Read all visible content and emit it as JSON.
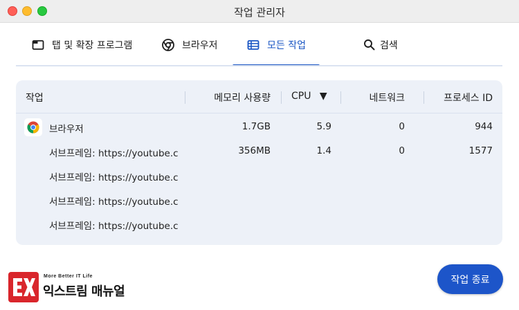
{
  "window": {
    "title": "작업 관리자"
  },
  "tabs": [
    {
      "label": "탭 및 확장 프로그램",
      "icon": "tab-window-icon"
    },
    {
      "label": "브라우저",
      "icon": "chrome-icon"
    },
    {
      "label": "모든 작업",
      "icon": "list-table-icon",
      "active": true
    },
    {
      "label": "검색",
      "icon": "search-icon"
    }
  ],
  "table": {
    "headers": {
      "task": "작업",
      "memory": "메모리 사용량",
      "cpu": "CPU",
      "cpu_sort": "▼",
      "network": "네트워크",
      "pid": "프로세스 ID"
    },
    "rows": [
      {
        "name": "브라우저",
        "memory": "1.7GB",
        "cpu": "5.9",
        "network": "0",
        "pid": "944"
      },
      {
        "name": "서브프레임: https://youtube.com",
        "memory": "356MB",
        "cpu": "1.4",
        "network": "0",
        "pid": "1577"
      },
      {
        "name": "서브프레임: https://youtube.com",
        "memory": "",
        "cpu": "",
        "network": "",
        "pid": ""
      },
      {
        "name": "서브프레임: https://youtube.com",
        "memory": "",
        "cpu": "",
        "network": "",
        "pid": ""
      },
      {
        "name": "서브프레임: https://youtube.com",
        "memory": "",
        "cpu": "",
        "network": "",
        "pid": ""
      }
    ]
  },
  "footer": {
    "end_task_label": "작업 종료",
    "logo_small": "More Better IT Life",
    "logo_big": "익스트림 매뉴얼"
  },
  "colors": {
    "accent": "#1a56c4",
    "button": "#1d55c9",
    "panel": "#edf1f8",
    "logo": "#d9262c"
  }
}
